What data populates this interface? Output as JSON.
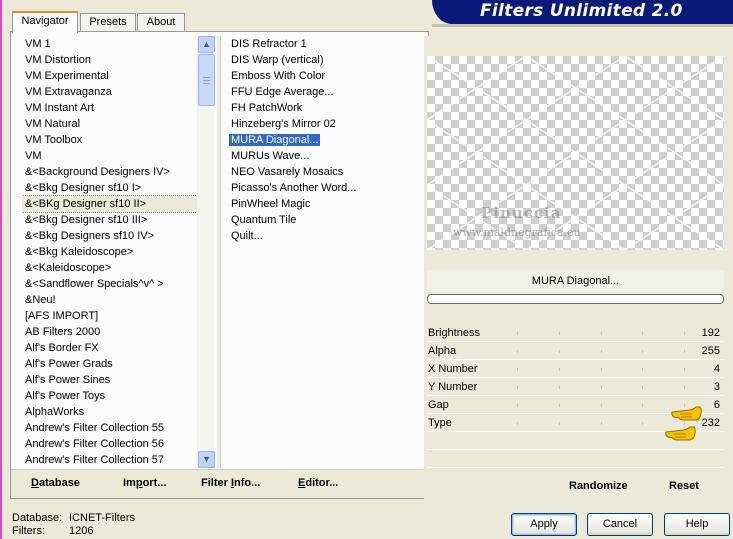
{
  "header": {
    "title": "Filters Unlimited 2.0"
  },
  "tabs": [
    {
      "label": "Navigator",
      "active": true
    },
    {
      "label": "Presets",
      "active": false
    },
    {
      "label": "About",
      "active": false
    }
  ],
  "categories": {
    "selected_index": 10,
    "items": [
      "VM 1",
      "VM Distortion",
      "VM Experimental",
      "VM Extravaganza",
      "VM Instant Art",
      "VM Natural",
      "VM Toolbox",
      "VM",
      "&<Background Designers IV>",
      "&<Bkg Designer sf10 I>",
      "&<BKg Designer sf10 II>",
      "&<Bkg Designer sf10 III>",
      "&<Bkg Designers sf10 IV>",
      "&<Bkg Kaleidoscope>",
      "&<Kaleidoscope>",
      "&<Sandflower Specials^v^ >",
      "&Neu!",
      "[AFS IMPORT]",
      "AB Filters 2000",
      "Alf's Border FX",
      "Alf's Power Grads",
      "Alf's Power Sines",
      "Alf's Power Toys",
      "AlphaWorks",
      "Andrew's Filter Collection 55",
      "Andrew's Filter Collection 56",
      "Andrew's Filter Collection 57"
    ]
  },
  "filters": {
    "selected_index": 6,
    "items": [
      "DIS Refractor 1",
      "DIS Warp (vertical)",
      "Emboss With Color",
      "FFU Edge Average...",
      "FH PatchWork",
      "Hinzeberg's Mirror 02",
      "MURA Diagonal...",
      "MURUs Wave...",
      "NEO Vasarely Mosaics",
      "Picasso's Another Word...",
      "PinWheel Magic",
      "Quantum Tile",
      "Quilt..."
    ]
  },
  "bottom_left": {
    "database": {
      "pre": "",
      "u": "D",
      "post": "atabase"
    },
    "import": {
      "pre": "Im",
      "u": "p",
      "post": "ort..."
    },
    "filter_info": {
      "pre": "Filter ",
      "u": "I",
      "post": "nfo..."
    },
    "editor": {
      "pre": "",
      "u": "E",
      "post": "ditor..."
    }
  },
  "preview": {
    "watermark_name": "Pinuccia",
    "watermark_url": "www.maldnegrafica.eu"
  },
  "effect_name": "MURA Diagonal...",
  "params": [
    {
      "name": "Brightness",
      "value": "192"
    },
    {
      "name": "Alpha",
      "value": "255"
    },
    {
      "name": "X Number",
      "value": "4"
    },
    {
      "name": "Y Number",
      "value": "3"
    },
    {
      "name": "Gap",
      "value": "6"
    },
    {
      "name": "Type",
      "value": "232"
    }
  ],
  "bottom_right": {
    "randomize": "Randomize",
    "reset": "Reset"
  },
  "status": {
    "database_label": "Database:",
    "database_value": "ICNET-Filters",
    "filters_label": "Filters:",
    "filters_value": "1206"
  },
  "dialog": {
    "apply": "Apply",
    "cancel": "Cancel",
    "help": "Help"
  },
  "colors": {
    "banner": "#0a1a78",
    "selection": "#316ac5",
    "face": "#ece9d8",
    "tab_accent": "#e68b2c"
  }
}
